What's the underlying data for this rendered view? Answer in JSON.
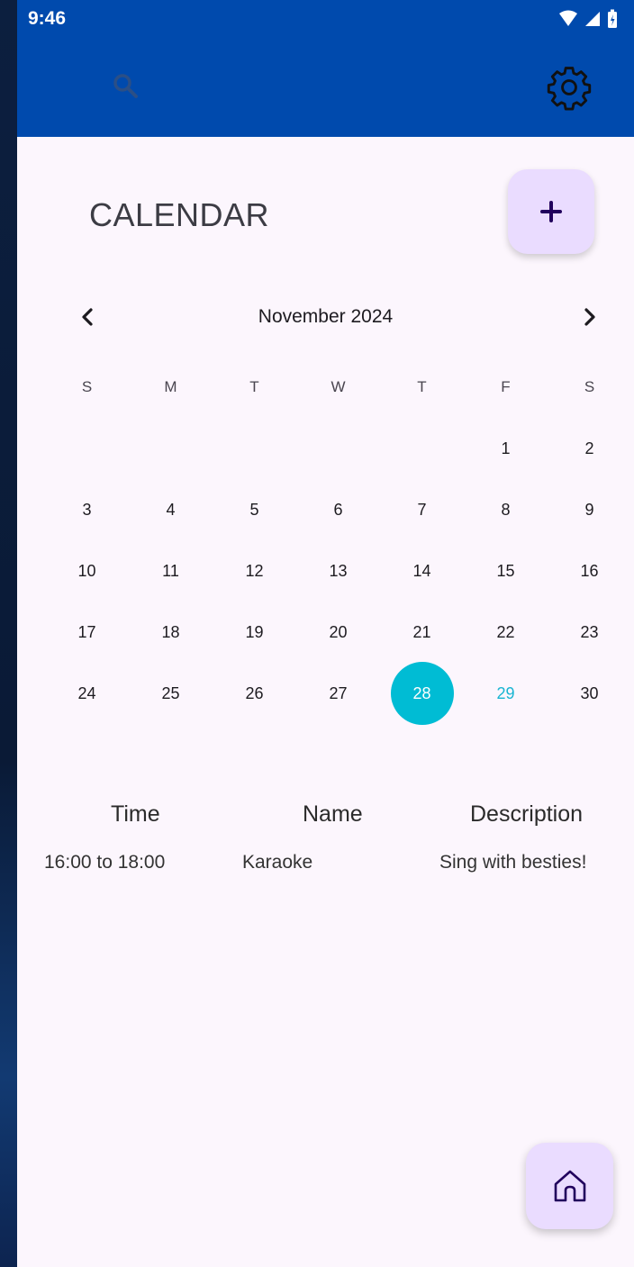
{
  "status_bar": {
    "time": "9:46"
  },
  "header": {
    "title": "CALENDAR"
  },
  "calendar": {
    "month_label": "November 2024",
    "weekdays": [
      "S",
      "M",
      "T",
      "W",
      "T",
      "F",
      "S"
    ],
    "weeks": [
      [
        "",
        "",
        "",
        "",
        "",
        "1",
        "2"
      ],
      [
        "3",
        "4",
        "5",
        "6",
        "7",
        "8",
        "9"
      ],
      [
        "10",
        "11",
        "12",
        "13",
        "14",
        "15",
        "16"
      ],
      [
        "17",
        "18",
        "19",
        "20",
        "21",
        "22",
        "23"
      ],
      [
        "24",
        "25",
        "26",
        "27",
        "28",
        "29",
        "30"
      ]
    ],
    "selected_day": "28",
    "today": "29"
  },
  "events": {
    "columns": [
      "Time",
      "Name",
      "Description"
    ],
    "rows": [
      {
        "time": "16:00 to 18:00",
        "name": "Karaoke",
        "description": "Sing with besties!"
      }
    ]
  },
  "colors": {
    "appbar": "#004aad",
    "fab": "#eadcff",
    "selected": "#00bcd4",
    "background": "#fcf6fd"
  },
  "icons": {
    "search": "search-icon",
    "settings": "gear-icon",
    "add": "plus-icon",
    "prev": "chevron-left-icon",
    "next": "chevron-right-icon",
    "home": "home-icon"
  }
}
